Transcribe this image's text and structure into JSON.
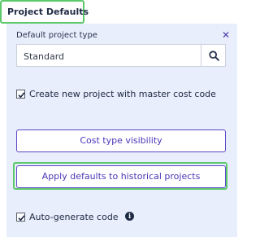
{
  "tab": {
    "label": "Project Defaults"
  },
  "form": {
    "project_type_label": "Default project type",
    "project_type_value": "Standard",
    "master_cost_code_label": "Create new project with master cost code",
    "master_cost_code_checked": true,
    "auto_generate_label": "Auto-generate code",
    "auto_generate_checked": true
  },
  "buttons": {
    "cost_type_visibility": "Cost type visibility",
    "apply_defaults": "Apply defaults to historical projects"
  },
  "icons": {
    "close": "close-icon",
    "search": "search-icon",
    "info": "info-icon",
    "checkbox": "checkmark-icon"
  },
  "colors": {
    "panel_background": "#e8eefb",
    "button_border": "#5a47c8",
    "button_text": "#4a36b8",
    "highlight": "#5cc96a"
  }
}
